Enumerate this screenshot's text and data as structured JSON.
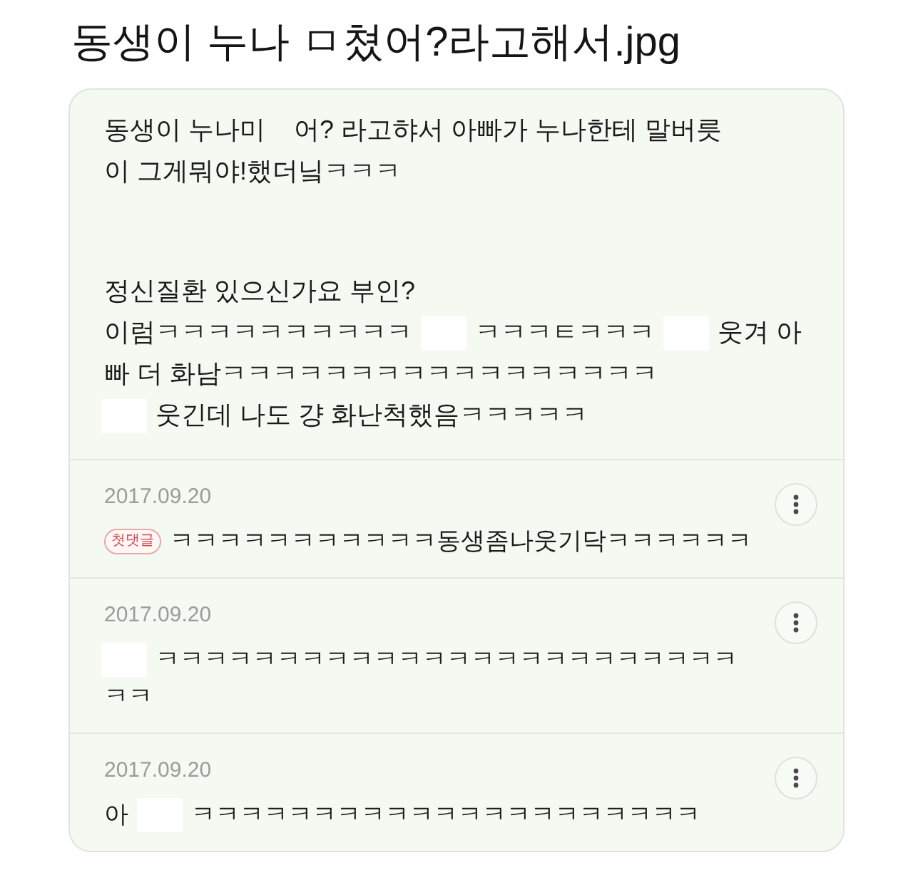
{
  "title": "동생이 누나 ㅁ쳤어?라고해서.jpg",
  "post": {
    "paragraphs": [
      [
        [
          {
            "kind": "text",
            "text": "동생이 누나미    어? 라고햐서 아빠가 누나한테 말버릇"
          }
        ],
        [
          {
            "kind": "text",
            "text": "이 그게뭐야!했더닠ㅋㅋㅋ"
          }
        ]
      ],
      [
        [
          {
            "kind": "text",
            "text": "정신질환 있으신가요 부인?"
          }
        ],
        [
          {
            "kind": "text",
            "text": "이럼ㅋㅋㅋㅋㅋㅋㅋㅋㅋㅋ"
          },
          {
            "kind": "redacted"
          },
          {
            "kind": "text",
            "text": "ㅋㅋㅋㅌㅋㅋㅋ"
          },
          {
            "kind": "redacted"
          },
          {
            "kind": "text",
            "text": "웃겨 아"
          }
        ],
        [
          {
            "kind": "text",
            "text": "빠 더 화남ㅋㅋㅋㅋㅋㅋㅋㅋㅋㅋㅋㅋㅋㅋㅋㅋㅋ"
          }
        ],
        [
          {
            "kind": "redacted"
          },
          {
            "kind": "text",
            "text": "웃긴데 나도 걍 화난척했음ㅋㅋㅋㅋㅋ"
          }
        ]
      ]
    ]
  },
  "comments": [
    {
      "date": "2017.09.20",
      "badge": "첫댓글",
      "lines": [
        [
          {
            "kind": "text",
            "text": "ㅋㅋㅋㅋㅋㅋㅋㅋㅋㅋㅋ동생좀나웃기닥ㅋㅋㅋㅋㅋㅋ"
          }
        ]
      ]
    },
    {
      "date": "2017.09.20",
      "lines": [
        [
          {
            "kind": "redacted"
          },
          {
            "kind": "text",
            "text": "ㅋㅋㅋㅋㅋㅋㅋㅋㅋㅋㅋㅋㅋㅋㅋㅋㅋㅋㅋㅋㅋㅋㅋㅋ"
          }
        ],
        [
          {
            "kind": "text",
            "text": "ㅋㅋ"
          }
        ]
      ]
    },
    {
      "date": "2017.09.20",
      "lines": [
        [
          {
            "kind": "text",
            "text": "아"
          },
          {
            "kind": "redacted"
          },
          {
            "kind": "text",
            "text": "ㅋㅋㅋㅋㅋㅋㅋㅋㅋㅋㅋㅋㅋㅋㅋㅋㅋㅋㅋㅋㅋ"
          }
        ]
      ]
    }
  ]
}
